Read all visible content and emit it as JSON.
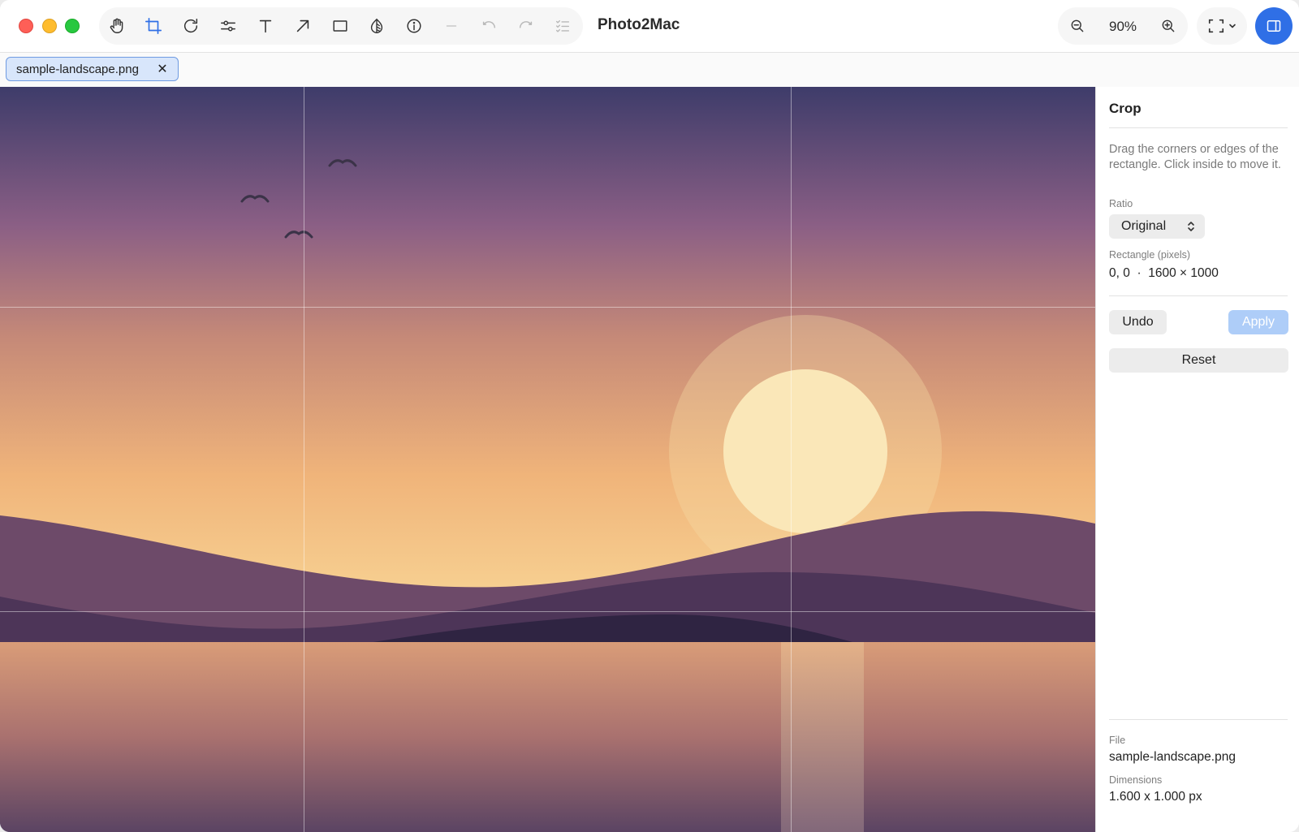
{
  "window": {
    "app_title": "Photo2Mac"
  },
  "toolbar": {
    "tools": [
      "hand-icon",
      "crop-icon",
      "rotate-icon",
      "adjust-sliders-icon",
      "text-icon",
      "arrow-icon",
      "rectangle-icon",
      "redact-icon",
      "info-icon",
      "line-icon",
      "undo-icon",
      "redo-icon",
      "checklist-icon"
    ],
    "active_tool": "crop-icon",
    "zoom_level": "90%",
    "accent_color": "#2f6fe6"
  },
  "tabs": [
    {
      "label": "sample-landscape.png",
      "active": true
    }
  ],
  "inspector": {
    "title": "Crop",
    "description": "Drag the corners or edges of the rectangle. Click inside to move it.",
    "ratio_label": "Ratio",
    "ratio_value": "Original",
    "rect_label": "Rectangle (pixels)",
    "rect_value": "0, 0  ·  1600 × 1000",
    "undo_label": "Undo",
    "apply_label": "Apply",
    "reset_label": "Reset",
    "file_label": "File",
    "file_value": "sample-landscape.png",
    "dimensions_label": "Dimensions",
    "dimensions_value": "1.600 x 1.000 px"
  }
}
